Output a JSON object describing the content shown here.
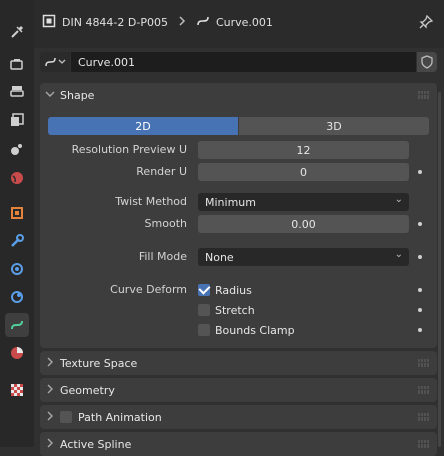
{
  "header": {
    "object_name": "DIN 4844-2 D-P005",
    "data_name": "Curve.001"
  },
  "datablock": {
    "name": "Curve.001"
  },
  "shape": {
    "title": "Shape",
    "mode_2d": "2D",
    "mode_3d": "3D",
    "resolution_preview_u": {
      "label": "Resolution Preview U",
      "value": "12"
    },
    "render_u": {
      "label": "Render U",
      "value": "0"
    },
    "twist_method": {
      "label": "Twist Method",
      "value": "Minimum"
    },
    "smooth": {
      "label": "Smooth",
      "value": "0.00"
    },
    "fill_mode": {
      "label": "Fill Mode",
      "value": "None"
    },
    "curve_deform": {
      "label": "Curve Deform",
      "radius": {
        "label": "Radius",
        "checked": true
      },
      "stretch": {
        "label": "Stretch",
        "checked": false
      },
      "bounds_clamp": {
        "label": "Bounds Clamp",
        "checked": false
      }
    }
  },
  "panels": {
    "texture_space": "Texture Space",
    "geometry": "Geometry",
    "path_animation": "Path Animation",
    "active_spline": "Active Spline"
  },
  "colors": {
    "accent": "#4772b3",
    "background": "#303030",
    "panel": "#3d3d3d"
  },
  "sidebar_icons": [
    "tool-icon",
    "render-icon",
    "output-icon",
    "view-layer-icon",
    "scene-icon",
    "world-icon",
    "object-icon",
    "modifier-icon",
    "particles-icon",
    "physics-icon",
    "curve-data-icon",
    "material-icon",
    "texture-icon"
  ]
}
